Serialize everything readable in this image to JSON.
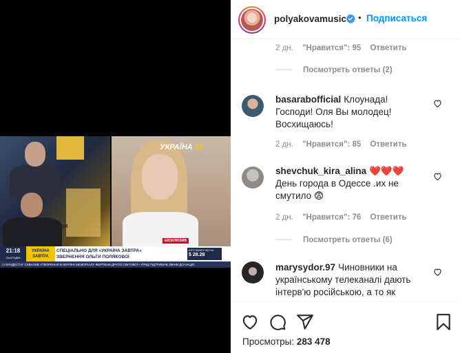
{
  "media": {
    "channel_logo_text": "УКРАЇНА",
    "channel_logo_num": "24",
    "shirt_text": "THE I OBSTER",
    "exclusive": "ЕКСКЛЮЗИВ",
    "time": "21:18",
    "time_sub": "СЬОГОДНІ",
    "show_name": "УКРАЇНА ЗАВТРА",
    "caption_line1": "СПЕЦІАЛЬНО ДЛЯ «УКРАЇНА ЗАВТРА»",
    "caption_line2": "ЗВЕРНЕННЯ ОЛЬГИ ПОЛЯКОВОЇ",
    "rate_label": "КУРС ВАЛЮТ НБУ НА",
    "rate_value": "$ 28.28",
    "ticker_num": "19",
    "ticker_text": "БУНДЕСТАГ СХВАЛИВ УТВОРЕННЯ В БЕРЛІНІ МЕМОРІАЛУ ЖЕРТВАМ ДРУГОЇ СВІТОВОЇ  •  УРЯД ПІДТРИМАВ ЗМІНИ ДО НАЦІО"
  },
  "header": {
    "username": "polyakovamusic",
    "separator": "•",
    "follow_label": "Подписаться"
  },
  "comments": [
    {
      "meta_time": "2 дн.",
      "meta_likes": "\"Нравится\": 95",
      "meta_reply": "Ответить",
      "view_replies": "Посмотреть ответы (2)"
    },
    {
      "username": "basarabofficial",
      "text": "Клоунада! Господи! Оля Вы молодец! Восхищаюсь!",
      "meta_time": "2 дн.",
      "meta_likes": "\"Нравится\": 85",
      "meta_reply": "Ответить"
    },
    {
      "username": "shevchuk_kira_alina",
      "text_emoji": "❤️❤️❤️",
      "text": "День города в Одессе .их не смутило 😨",
      "meta_time": "2 дн.",
      "meta_likes": "\"Нравится\": 76",
      "meta_reply": "Ответить",
      "view_replies": "Посмотреть ответы (6)"
    },
    {
      "username": "marysydor.97",
      "text": "Чиновники на українському телеканалі дають інтерв'ю російською, а то як"
    }
  ],
  "footer": {
    "views_label": "Просмотры:",
    "views_count": "283 478"
  }
}
